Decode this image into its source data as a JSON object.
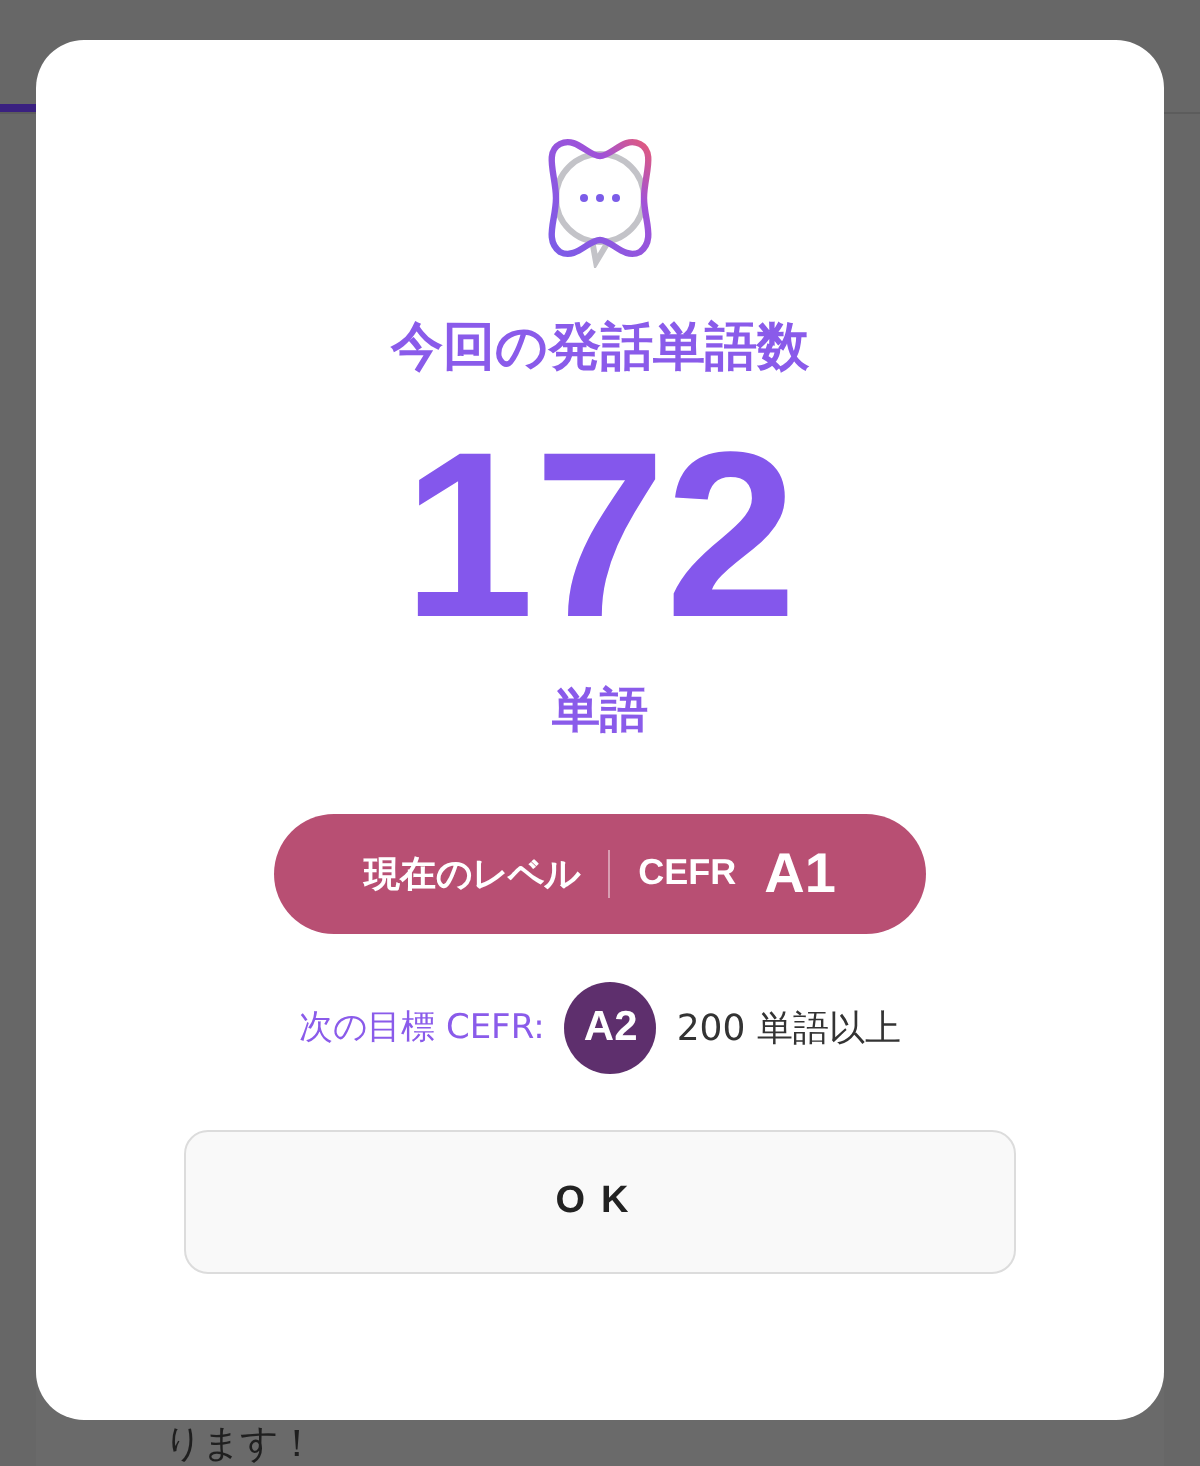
{
  "background": {
    "text": "ります！"
  },
  "dialog": {
    "title": "今回の発話単語数",
    "count": "172",
    "unit": "単語",
    "level": {
      "label": "現在のレベル",
      "scale": "CEFR",
      "value": "A1"
    },
    "next_goal": {
      "label": "次の目標 CEFR:",
      "level": "A2",
      "requirement": "200 単語以上"
    },
    "button": "OK"
  }
}
